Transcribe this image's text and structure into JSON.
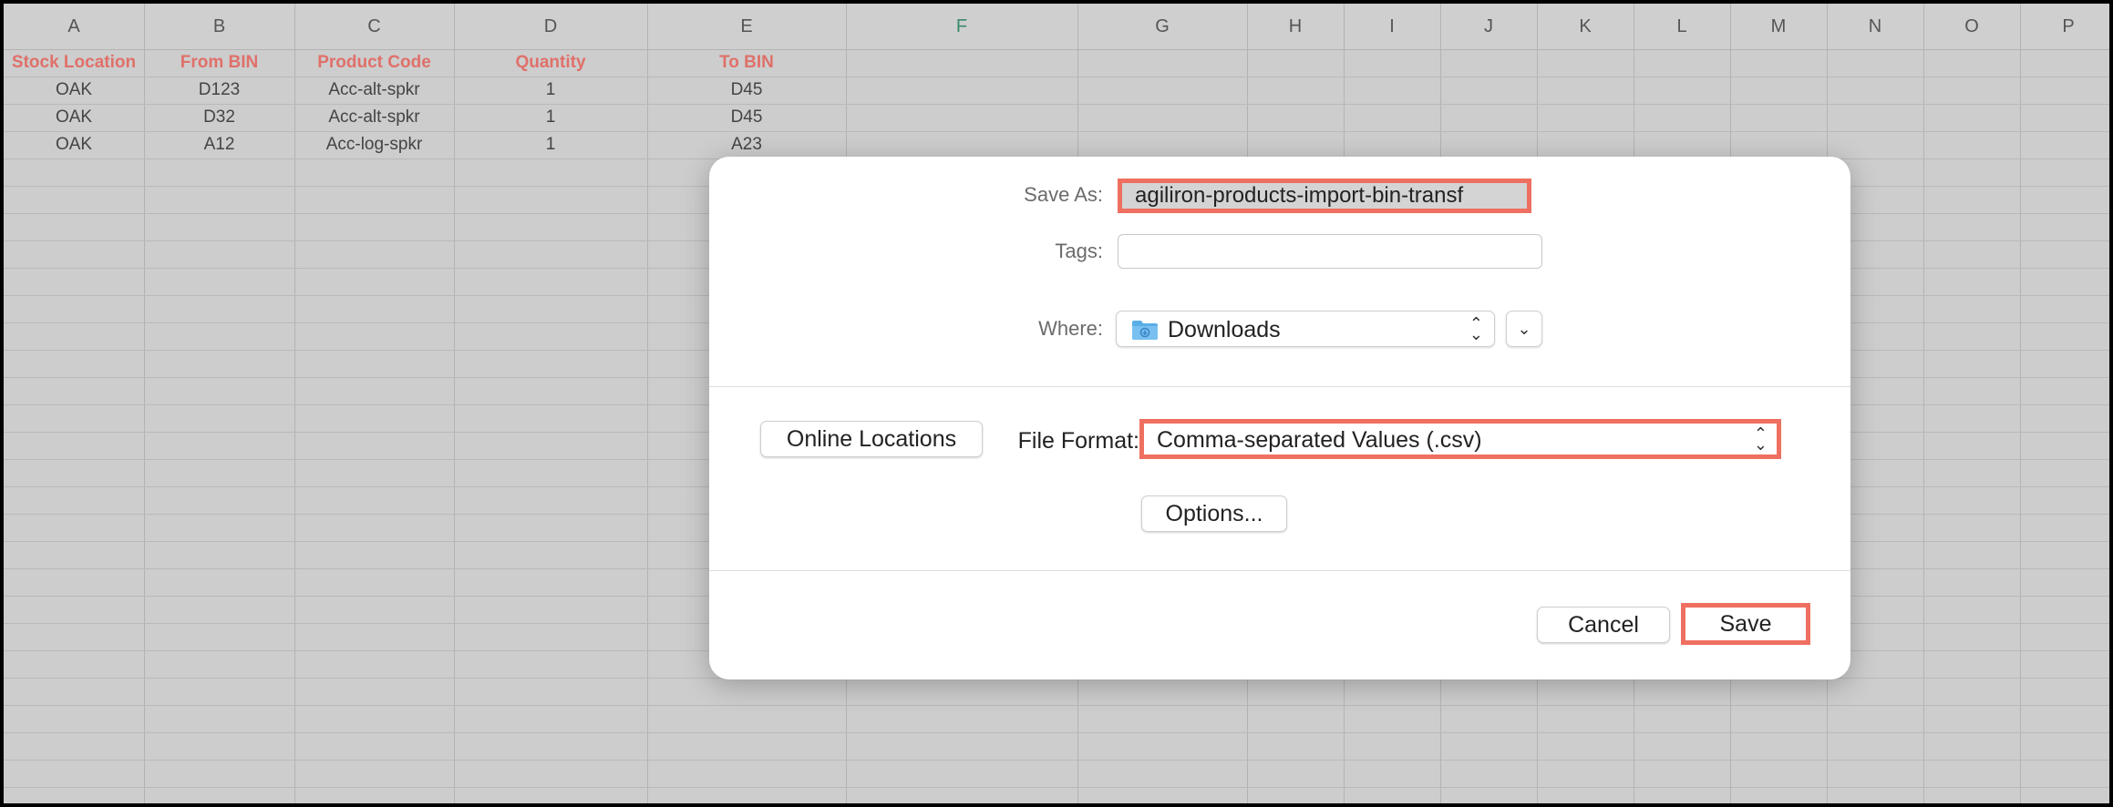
{
  "spreadsheet": {
    "columns": [
      "A",
      "B",
      "C",
      "D",
      "E",
      "F",
      "G",
      "H",
      "I",
      "J",
      "K",
      "L",
      "M",
      "N",
      "O",
      "P"
    ],
    "headers": [
      "Stock Location",
      "From BIN",
      "Product Code",
      "Quantity",
      "To BIN"
    ],
    "rows": [
      [
        "OAK",
        "D123",
        "Acc-alt-spkr",
        "1",
        "D45"
      ],
      [
        "OAK",
        "D32",
        "Acc-alt-spkr",
        "1",
        "D45"
      ],
      [
        "OAK",
        "A12",
        "Acc-log-spkr",
        "1",
        "A23"
      ]
    ],
    "header_color": "#e0706a"
  },
  "dialog": {
    "save_as_label": "Save As:",
    "save_as_value": "agiliron-products-import-bin-transf",
    "tags_label": "Tags:",
    "tags_value": "",
    "where_label": "Where:",
    "where_value": "Downloads",
    "where_icon": "folder-icon",
    "online_locations_label": "Online Locations",
    "file_format_label": "File Format:",
    "file_format_value": "Comma-separated Values (.csv)",
    "options_label": "Options...",
    "cancel_label": "Cancel",
    "save_label": "Save",
    "highlight_color": "#ef6f60"
  }
}
